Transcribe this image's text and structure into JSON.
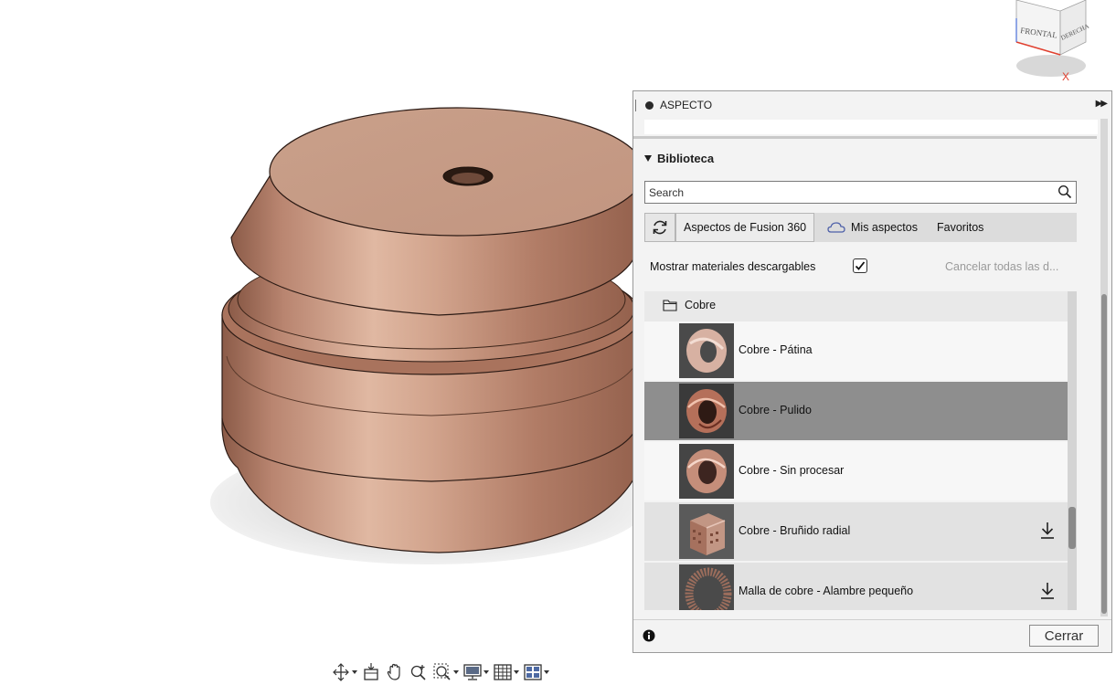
{
  "panel": {
    "title": "ASPECTO",
    "library_title": "Biblioteca",
    "search": {
      "placeholder": "Search",
      "value": ""
    },
    "tabs": [
      {
        "label": "Aspectos de Fusion 360",
        "active": true
      },
      {
        "label": "Mis aspectos",
        "active": false
      },
      {
        "label": "Favoritos",
        "active": false
      }
    ],
    "show_downloadable_label": "Mostrar materiales descargables",
    "show_downloadable_checked": true,
    "cancel_downloads_label": "Cancelar todas las d...",
    "folder": {
      "label": "Cobre"
    },
    "items": [
      {
        "label": "Cobre - Pátina",
        "selected": false,
        "downloadable": false
      },
      {
        "label": "Cobre - Pulido",
        "selected": true,
        "downloadable": false
      },
      {
        "label": "Cobre - Sin procesar",
        "selected": false,
        "downloadable": false
      },
      {
        "label": "Cobre - Bruñido radial",
        "selected": false,
        "downloadable": true
      },
      {
        "label": "Malla de cobre - Alambre pequeño",
        "selected": false,
        "downloadable": true
      }
    ],
    "close_label": "Cerrar"
  },
  "viewcube": {
    "front_label": "FRONTAL",
    "right_label": "DERECHA",
    "axis_label": "X"
  },
  "colors": {
    "panel_bg": "#f3f3f3",
    "selected_row": "#8e8e8e",
    "copper_light": "#d9ab94",
    "copper_dark": "#9c6a55",
    "axis_x": "#e0402f"
  },
  "toolbar": {
    "icons": [
      "orbit-icon",
      "look-at-icon",
      "pan-icon",
      "zoom-icon",
      "fit-icon",
      "display-icon",
      "grid-icon",
      "viewports-icon"
    ]
  }
}
